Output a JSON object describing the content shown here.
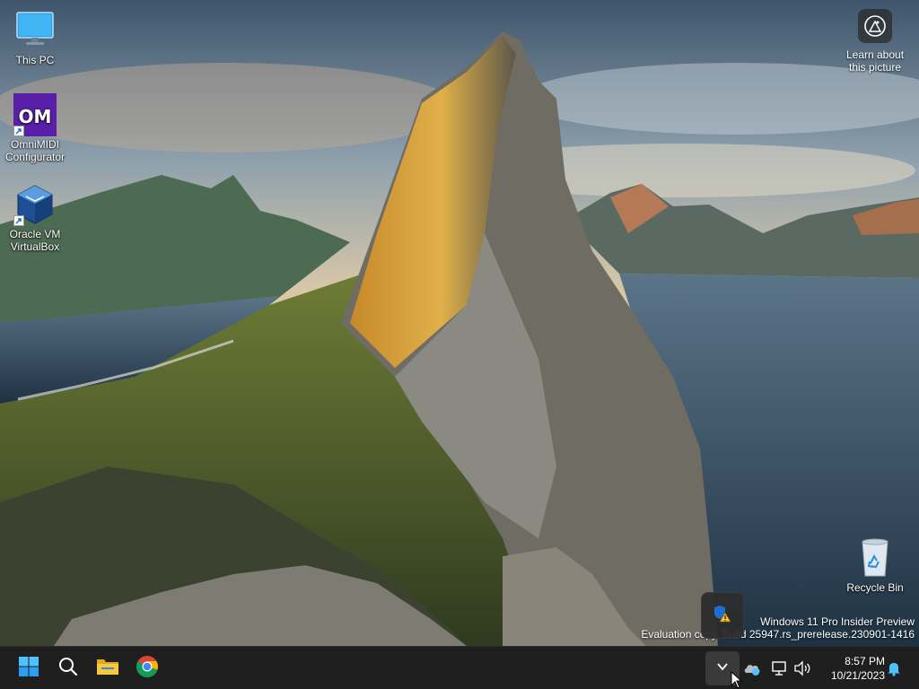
{
  "desktop": {
    "icons": [
      {
        "label": "This PC"
      },
      {
        "label": "OmniMIDI Configurator",
        "logo_text": "OM"
      },
      {
        "label": "Oracle VM VirtualBox"
      },
      {
        "label": "Recycle Bin"
      }
    ],
    "learn_picture": {
      "line1": "Learn about",
      "line2": "this picture"
    },
    "watermark": {
      "line1": "Windows 11 Pro Insider Preview",
      "line2": "Evaluation copy. Build 25947.rs_prerelease.230901-1416"
    }
  },
  "taskbar": {
    "apps": [
      {
        "icon": "windows-start-icon"
      },
      {
        "icon": "search-icon"
      },
      {
        "icon": "file-explorer-icon"
      },
      {
        "icon": "chrome-icon"
      }
    ],
    "tray": {
      "flyout_icons": [
        "windows-security-warning-icon"
      ],
      "icons": [
        "chevron-up-icon",
        "onedrive-icon",
        "network-icon",
        "volume-icon"
      ]
    },
    "clock": {
      "time": "8:57 PM",
      "date": "10/21/2023"
    },
    "notification_icon": "bell-icon"
  },
  "colors": {
    "taskbar": "#1f1f1f",
    "accent": "#4cc2ff",
    "omnimidi": "#5a1fa8"
  }
}
